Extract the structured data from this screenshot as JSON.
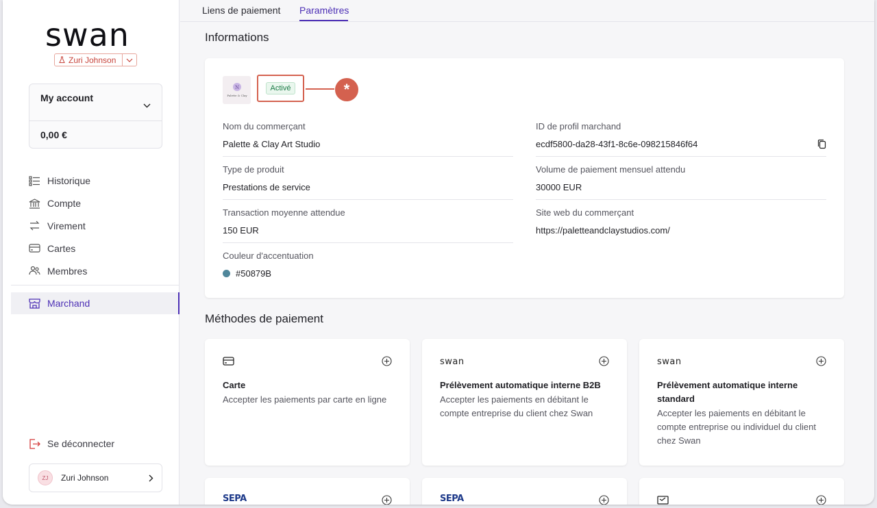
{
  "brand": {
    "logo": "swan"
  },
  "user_switch": {
    "name": "Zuri Johnson"
  },
  "account": {
    "label": "My account",
    "balance": "0,00 €"
  },
  "nav": {
    "items": [
      {
        "label": "Historique",
        "icon": "list-icon"
      },
      {
        "label": "Compte",
        "icon": "bank-icon"
      },
      {
        "label": "Virement",
        "icon": "transfer-icon"
      },
      {
        "label": "Cartes",
        "icon": "card-icon"
      },
      {
        "label": "Membres",
        "icon": "members-icon"
      }
    ],
    "active": {
      "label": "Marchand",
      "icon": "store-icon"
    }
  },
  "logout": {
    "label": "Se déconnecter"
  },
  "user_card": {
    "initials": "ZJ",
    "name": "Zuri Johnson"
  },
  "tabs": [
    {
      "label": "Liens de paiement"
    },
    {
      "label": "Paramètres",
      "active": true
    }
  ],
  "info": {
    "title": "Informations",
    "thumb_text": "Palette & Clay",
    "status": "Activé",
    "annotation": "*",
    "fields_left": [
      {
        "label": "Nom du commerçant",
        "value": "Palette & Clay Art Studio"
      },
      {
        "label": "Type de produit",
        "value": "Prestations de service"
      },
      {
        "label": "Transaction moyenne attendue",
        "value": "150 EUR"
      },
      {
        "label": "Couleur d'accentuation",
        "value": "#50879B"
      }
    ],
    "fields_right": [
      {
        "label": "ID de profil marchand",
        "value": "ecdf5800-da28-43f1-8c6e-098215846f64"
      },
      {
        "label": "Volume de paiement mensuel attendu",
        "value": "30000 EUR"
      },
      {
        "label": "Site web du commerçant",
        "value": "https://paletteandclaystudios.com/"
      }
    ],
    "accent_color": "#50879B"
  },
  "payment_methods": {
    "title": "Méthodes de paiement",
    "cards": [
      {
        "icon": "card-icon",
        "title": "Carte",
        "desc": "Accepter les paiements par carte en ligne"
      },
      {
        "logo": "swan",
        "title": "Prélèvement automatique interne B2B",
        "desc": "Accepter les paiements en débitant le compte entreprise du client chez Swan"
      },
      {
        "logo": "swan",
        "title": "Prélèvement automatique interne standard",
        "desc": "Accepter les paiements en débitant le compte entreprise ou individuel du client chez Swan"
      }
    ],
    "bottom_cards": [
      {
        "logo": "SEPA"
      },
      {
        "logo": "SEPA"
      },
      {
        "icon": "check-icon"
      }
    ]
  },
  "colors": {
    "accent": "#4c2fb5",
    "highlight": "#d4614f",
    "status_green": "#1a7a45"
  }
}
